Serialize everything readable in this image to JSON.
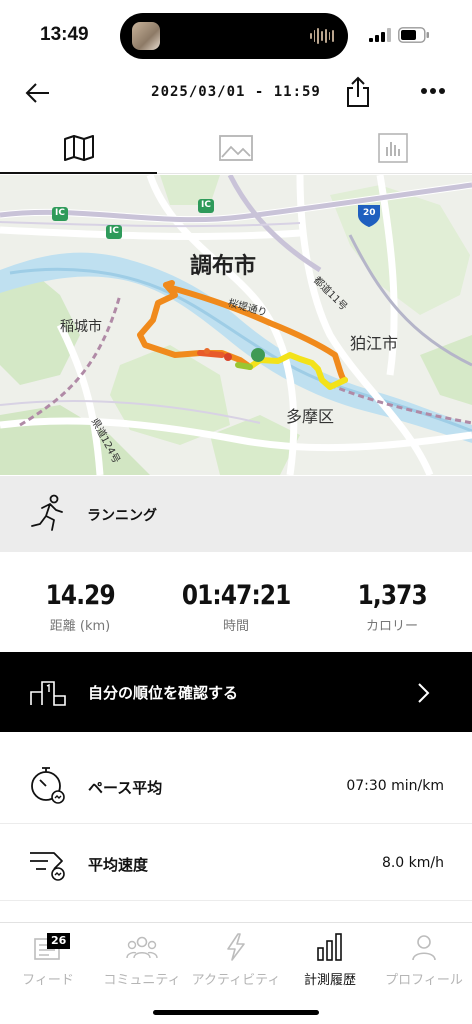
{
  "status_bar": {
    "time": "13:49"
  },
  "header": {
    "title": "2025/03/01 - 11:59"
  },
  "tabs": [
    {
      "icon": "map-icon",
      "active": true
    },
    {
      "icon": "photo-icon",
      "active": false
    },
    {
      "icon": "chart-icon",
      "active": false
    }
  ],
  "map": {
    "labels": {
      "chofu": "調布市",
      "inagi": "稲城市",
      "komae": "狛江市",
      "tama": "多摩区",
      "sakurazutsumi": "桜堤通り",
      "todo11": "都道11号",
      "kendo124": "県道124号",
      "ic": "IC",
      "route20": "20"
    },
    "route_color": "#f08a1c"
  },
  "activity": {
    "type": "ランニング"
  },
  "stats": {
    "distance": {
      "value": "14.29",
      "label": "距離 (km)"
    },
    "duration": {
      "value": "01:47:21",
      "label": "時間"
    },
    "calories": {
      "value": "1,373",
      "label": "カロリー"
    }
  },
  "ranking": {
    "label": "自分の順位を確認する"
  },
  "rows": {
    "pace": {
      "label": "ペース平均",
      "value": "07:30 min/km"
    },
    "speed": {
      "label": "平均速度",
      "value": "8.0 km/h"
    }
  },
  "nav": {
    "feed": {
      "label": "フィード",
      "badge": "26"
    },
    "community": {
      "label": "コミュニティ"
    },
    "activity": {
      "label": "アクティビティ"
    },
    "history": {
      "label": "計測履歴"
    },
    "profile": {
      "label": "プロフィール"
    }
  }
}
